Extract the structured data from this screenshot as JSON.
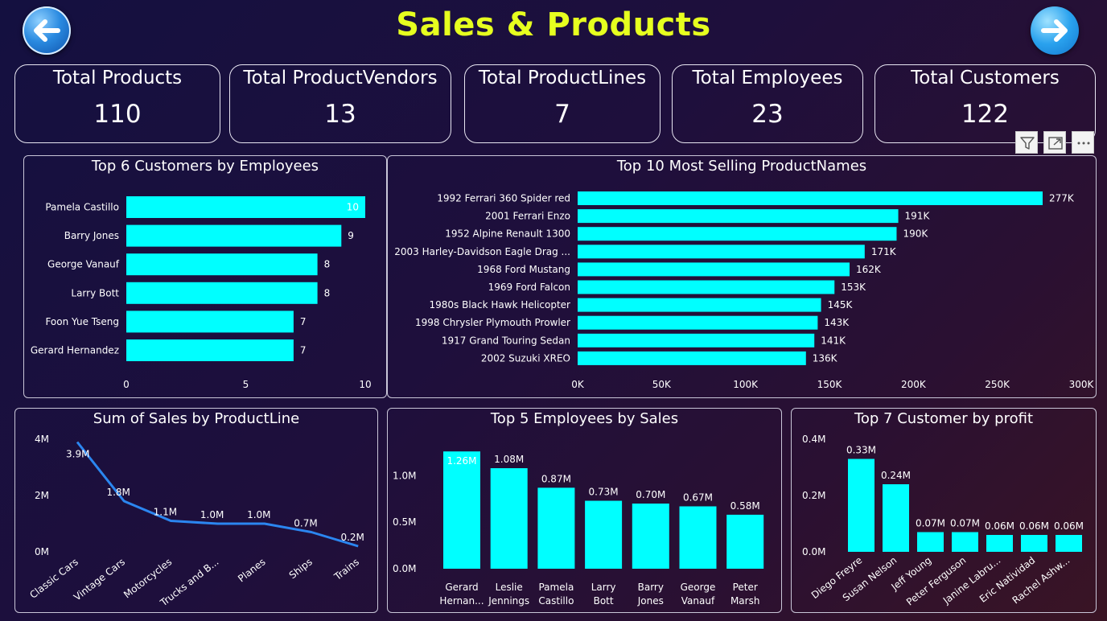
{
  "page_title": "Sales & Products",
  "nav": {
    "back_icon": "arrow-left-icon",
    "forward_icon": "arrow-right-icon"
  },
  "colors": {
    "bar": "#00ffff",
    "line": "#2b86f0",
    "title": "#e6ff1f",
    "text": "#ffffff"
  },
  "kpis": [
    {
      "label": "Total Products",
      "value": "110"
    },
    {
      "label": "Total ProductVendors",
      "value": "13"
    },
    {
      "label": "Total ProductLines",
      "value": "7"
    },
    {
      "label": "Total Employees",
      "value": "23"
    },
    {
      "label": "Total Customers",
      "value": "122"
    }
  ],
  "visual_header_icons": [
    "filter-icon",
    "focus-mode-icon",
    "more-options-icon"
  ],
  "chart_data": [
    {
      "id": "customers",
      "type": "bar",
      "orientation": "horizontal",
      "title": "Top 6 Customers by Employees",
      "categories": [
        "Pamela Castillo",
        "Barry Jones",
        "George Vanauf",
        "Larry Bott",
        "Foon Yue Tseng",
        "Gerard Hernandez"
      ],
      "values": [
        10,
        9,
        8,
        8,
        7,
        7
      ],
      "data_labels": [
        "10",
        "9",
        "8",
        "8",
        "7",
        "7"
      ],
      "xlim": [
        0,
        10
      ],
      "x_ticks": [
        0,
        5,
        10
      ],
      "x_tick_labels": [
        "0",
        "5",
        "10"
      ],
      "grid": false
    },
    {
      "id": "products",
      "type": "bar",
      "orientation": "horizontal",
      "title": "Top 10 Most Selling ProductNames",
      "categories": [
        "1992 Ferrari 360 Spider red",
        "2001 Ferrari Enzo",
        "1952 Alpine Renault 1300",
        "2003 Harley-Davidson Eagle Drag ...",
        "1968 Ford Mustang",
        "1969 Ford Falcon",
        "1980s Black Hawk Helicopter",
        "1998 Chrysler Plymouth Prowler",
        "1917 Grand Touring Sedan",
        "2002 Suzuki XREO"
      ],
      "values": [
        277000,
        191000,
        190000,
        171000,
        162000,
        153000,
        145000,
        143000,
        141000,
        136000
      ],
      "data_labels": [
        "277K",
        "191K",
        "190K",
        "171K",
        "162K",
        "153K",
        "145K",
        "143K",
        "141K",
        "136K"
      ],
      "xlim": [
        0,
        300000
      ],
      "x_ticks": [
        0,
        50000,
        100000,
        150000,
        200000,
        250000,
        300000
      ],
      "x_tick_labels": [
        "0K",
        "50K",
        "100K",
        "150K",
        "200K",
        "250K",
        "300K"
      ],
      "grid": false
    },
    {
      "id": "productline",
      "type": "line",
      "title": "Sum of Sales by ProductLine",
      "categories": [
        "Classic Cars",
        "Vintage Cars",
        "Motorcycles",
        "Trucks and B...",
        "Planes",
        "Ships",
        "Trains"
      ],
      "values": [
        3900000,
        1800000,
        1100000,
        1000000,
        1000000,
        700000,
        200000
      ],
      "data_labels": [
        "3.9M",
        "1.8M",
        "1.1M",
        "1.0M",
        "1.0M",
        "0.7M",
        "0.2M"
      ],
      "ylim": [
        0,
        4000000
      ],
      "y_ticks": [
        0,
        2000000,
        4000000
      ],
      "y_tick_labels": [
        "0M",
        "2M",
        "4M"
      ],
      "grid": false
    },
    {
      "id": "employees",
      "type": "bar",
      "orientation": "vertical",
      "title": "Top 5 Employees by Sales",
      "categories": [
        [
          "Gerard",
          "Hernan..."
        ],
        [
          "Leslie",
          "Jennings"
        ],
        [
          "Pamela",
          "Castillo"
        ],
        [
          "Larry",
          "Bott"
        ],
        [
          "Barry",
          "Jones"
        ],
        [
          "George",
          "Vanauf"
        ],
        [
          "Peter",
          "Marsh"
        ]
      ],
      "values": [
        1260000,
        1080000,
        870000,
        730000,
        700000,
        670000,
        580000
      ],
      "data_labels": [
        "1.26M",
        "1.08M",
        "0.87M",
        "0.73M",
        "0.70M",
        "0.67M",
        "0.58M"
      ],
      "ylim": [
        0,
        1400000
      ],
      "y_ticks": [
        0,
        500000,
        1000000
      ],
      "y_tick_labels": [
        "0.0M",
        "0.5M",
        "1.0M"
      ],
      "grid": false
    },
    {
      "id": "profit",
      "type": "bar",
      "orientation": "vertical",
      "title": "Top 7 Customer by profit",
      "categories": [
        "Diego Freyre",
        "Susan Nelson",
        "Jeff Young",
        "Peter Ferguson",
        "Janine Labru...",
        "Eric Natividad",
        "Rachel Ashw..."
      ],
      "values": [
        0.33,
        0.24,
        0.07,
        0.07,
        0.06,
        0.06,
        0.06
      ],
      "data_labels": [
        "0.33M",
        "0.24M",
        "0.07M",
        "0.07M",
        "0.06M",
        "0.06M",
        "0.06M"
      ],
      "ylim": [
        0,
        0.4
      ],
      "y_ticks": [
        0,
        0.2,
        0.4
      ],
      "y_tick_labels": [
        "0.0M",
        "0.2M",
        "0.4M"
      ],
      "grid": false
    }
  ]
}
